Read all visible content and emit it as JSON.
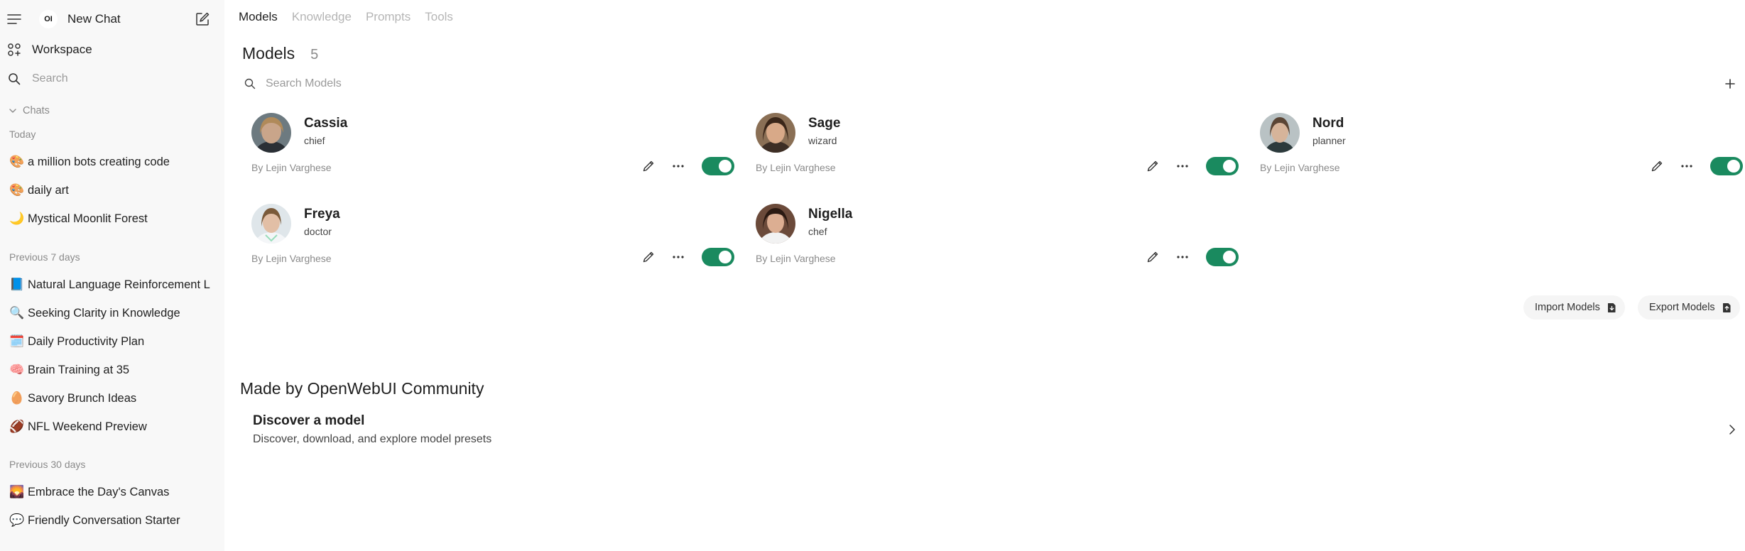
{
  "sidebar": {
    "logo_text": "OI",
    "new_chat_label": "New Chat",
    "workspace_label": "Workspace",
    "search_placeholder": "Search",
    "chats_section_label": "Chats",
    "groups": [
      {
        "label": "Today",
        "items": [
          {
            "emoji": "🎨",
            "title": "a million bots creating code"
          },
          {
            "emoji": "🎨",
            "title": "daily art"
          },
          {
            "emoji": "🌙",
            "title": "Mystical Moonlit Forest"
          }
        ]
      },
      {
        "label": "Previous 7 days",
        "items": [
          {
            "emoji": "📘",
            "title": "Natural Language Reinforcement L"
          },
          {
            "emoji": "🔍",
            "title": "Seeking Clarity in Knowledge"
          },
          {
            "emoji": "🗓️",
            "title": "Daily Productivity Plan"
          },
          {
            "emoji": "🧠",
            "title": "Brain Training at 35"
          },
          {
            "emoji": "🥚",
            "title": "Savory Brunch Ideas"
          },
          {
            "emoji": "🏈",
            "title": "NFL Weekend Preview"
          }
        ]
      },
      {
        "label": "Previous 30 days",
        "items": [
          {
            "emoji": "🌄",
            "title": "Embrace the Day's Canvas"
          },
          {
            "emoji": "💬",
            "title": "Friendly Conversation Starter"
          }
        ]
      }
    ]
  },
  "tabs": [
    {
      "label": "Models",
      "active": true
    },
    {
      "label": "Knowledge",
      "active": false
    },
    {
      "label": "Prompts",
      "active": false
    },
    {
      "label": "Tools",
      "active": false
    }
  ],
  "models": {
    "title": "Models",
    "count": "5",
    "search_placeholder": "Search Models",
    "items": [
      {
        "name": "Cassia",
        "role": "chief",
        "author": "By Lejin Varghese",
        "enabled": true
      },
      {
        "name": "Sage",
        "role": "wizard",
        "author": "By Lejin Varghese",
        "enabled": true
      },
      {
        "name": "Nord",
        "role": "planner",
        "author": "By Lejin Varghese",
        "enabled": true
      },
      {
        "name": "Freya",
        "role": "doctor",
        "author": "By Lejin Varghese",
        "enabled": true
      },
      {
        "name": "Nigella",
        "role": "chef",
        "author": "By Lejin Varghese",
        "enabled": true
      }
    ],
    "import_label": "Import Models",
    "export_label": "Export Models"
  },
  "community": {
    "title": "Made by OpenWebUI Community",
    "discover_title": "Discover a model",
    "discover_subtitle": "Discover, download, and explore model presets"
  },
  "colors": {
    "toggle_on": "#1a8a5f",
    "sidebar_bg": "#f8f8f8"
  }
}
